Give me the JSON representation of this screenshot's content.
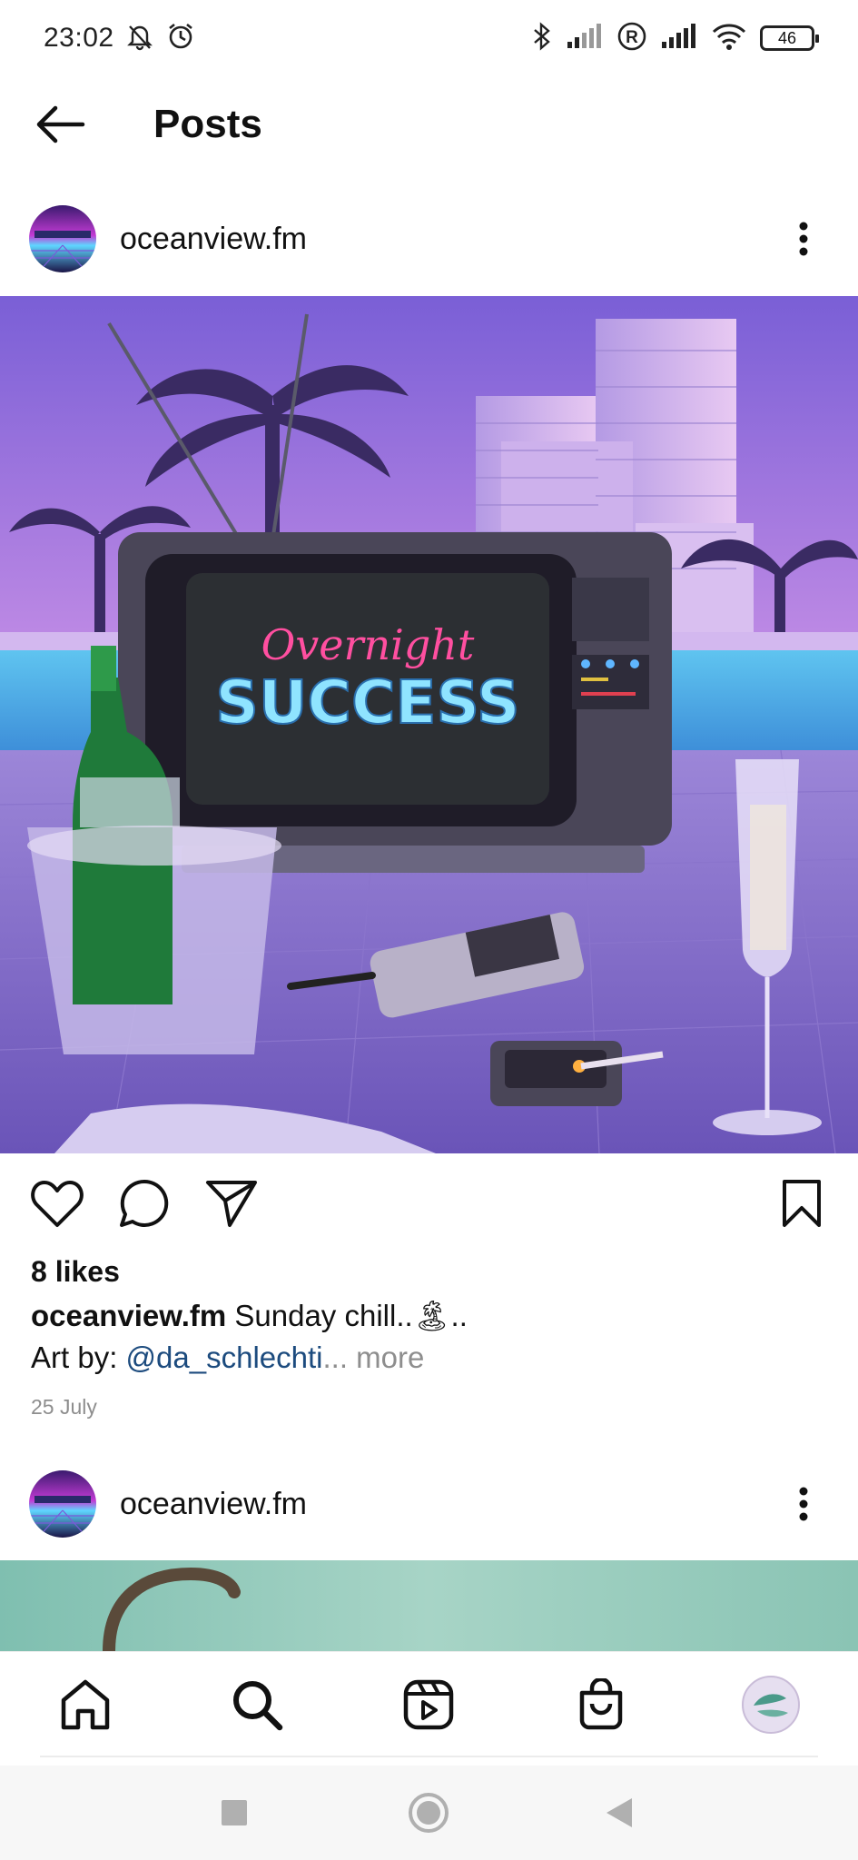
{
  "status_bar": {
    "time": "23:02",
    "battery": "46",
    "icons": [
      "mute-bell-icon",
      "alarm-icon",
      "bluetooth-icon",
      "signal-icon",
      "roaming-icon",
      "signal-icon",
      "wifi-icon",
      "battery-icon"
    ]
  },
  "header": {
    "title": "Posts",
    "back_icon": "back-arrow-icon"
  },
  "posts": [
    {
      "username": "oceanview.fm",
      "image": {
        "tv_script_text": "Overnight",
        "tv_title_text": "SUCCESS"
      },
      "likes": "8 likes",
      "caption_user": "oceanview.fm",
      "caption_text": "Sunday chill..🏝..",
      "caption_line2_prefix": "Art by: ",
      "caption_mention": "@da_schlechti",
      "caption_more": "... more",
      "date": "25 July"
    },
    {
      "username": "oceanview.fm"
    }
  ],
  "bottom_nav": {
    "items": [
      "home-icon",
      "search-icon",
      "reels-icon",
      "shop-icon",
      "profile-avatar"
    ]
  },
  "system_nav": {
    "items": [
      "recents-icon",
      "home-circle-icon",
      "back-triangle-icon"
    ]
  },
  "colors": {
    "mention": "#1c4b7e",
    "muted": "#8e8e8e",
    "image_purple": "#8a6fd0",
    "image_pool": "#4fb6e8"
  }
}
